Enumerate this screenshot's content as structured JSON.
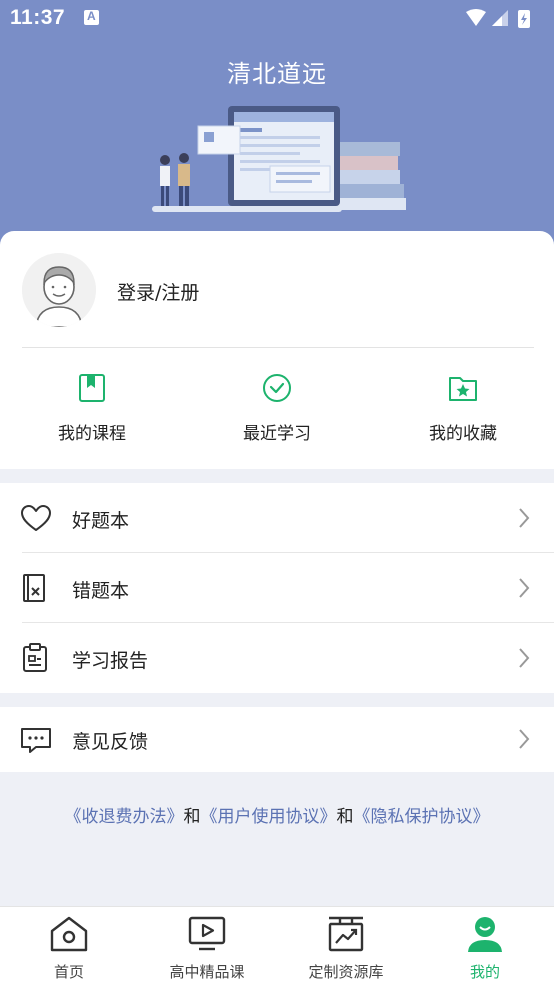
{
  "status_bar": {
    "time": "11:37",
    "notification_icon": "A"
  },
  "header": {
    "title": "清北道远"
  },
  "profile": {
    "login_label": "登录/注册"
  },
  "quick_actions": [
    {
      "label": "我的课程",
      "icon": "bookmark-icon"
    },
    {
      "label": "最近学习",
      "icon": "check-circle-icon"
    },
    {
      "label": "我的收藏",
      "icon": "star-folder-icon"
    }
  ],
  "menu_group_1": [
    {
      "label": "好题本",
      "icon": "heart-icon"
    },
    {
      "label": "错题本",
      "icon": "wrong-book-icon"
    },
    {
      "label": "学习报告",
      "icon": "clipboard-icon"
    }
  ],
  "menu_group_2": [
    {
      "label": "意见反馈",
      "icon": "chat-icon"
    }
  ],
  "agreement": {
    "link1": "《收退费办法》",
    "and1": "和",
    "link2": "《用户使用协议》",
    "and2": "和",
    "link3": "《隐私保护协议》"
  },
  "tabs": [
    {
      "label": "首页",
      "icon": "home-icon",
      "active": false
    },
    {
      "label": "高中精品课",
      "icon": "video-icon",
      "active": false
    },
    {
      "label": "定制资源库",
      "icon": "chart-board-icon",
      "active": false
    },
    {
      "label": "我的",
      "icon": "profile-icon",
      "active": true
    }
  ],
  "colors": {
    "header": "#7a8ec7",
    "accent": "#1db36d",
    "link": "#5b72b3"
  }
}
